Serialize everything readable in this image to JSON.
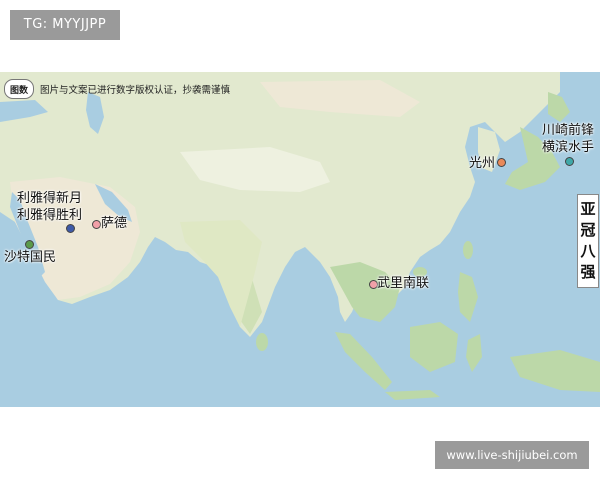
{
  "watermark_top": "TG: MYYJJPP",
  "watermark_bottom": "www.live-shijiubei.com",
  "map": {
    "logo_text": "图数",
    "notice": "图片与文案已进行数字版权认证，抄袭需谨慎",
    "title_vertical": [
      "亚",
      "冠",
      "八",
      "强"
    ],
    "teams": [
      {
        "name": "川崎前锋",
        "color": "#3fa8a8"
      },
      {
        "name": "横滨水手",
        "color": "#3fa8a8"
      },
      {
        "name": "光州",
        "color": "#e8895a"
      },
      {
        "name": "利雅得新月",
        "color": "#3e5aa8"
      },
      {
        "name": "利雅得胜利",
        "color": "#3e5aa8"
      },
      {
        "name": "萨德",
        "color": "#f2a0a8"
      },
      {
        "name": "沙特国民",
        "color": "#5a9a4a"
      },
      {
        "name": "武里南联",
        "color": "#f2a0a8"
      }
    ],
    "colors": {
      "sea": "#a9cde1",
      "land": "#e2e9cf",
      "desert": "#eee8d6",
      "forest": "#bcd8a8"
    }
  }
}
